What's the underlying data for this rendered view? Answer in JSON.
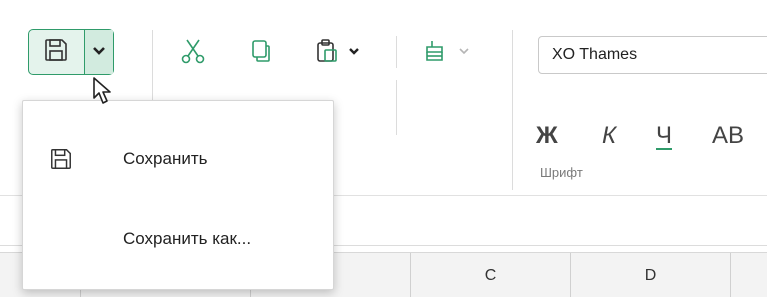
{
  "toolbar": {
    "save_split_button": {
      "icon": "save-icon",
      "dropdown_icon": "chevron-down-icon"
    },
    "clipboard": {
      "cut_icon": "scissors-icon",
      "copy_icon": "copy-icon",
      "paste_icon": "paste-icon",
      "paste_dropdown_icon": "chevron-down-icon"
    },
    "format_painter": {
      "icon": "format-painter-icon",
      "dropdown_icon": "chevron-down-icon"
    }
  },
  "font_group": {
    "font_name": "XO Thames",
    "bold_label": "Ж",
    "italic_label": "К",
    "underline_label": "Ч",
    "strike_label": "АВ",
    "label": "Шрифт"
  },
  "save_menu": {
    "items": [
      {
        "label": "Сохранить",
        "icon": "save-icon"
      },
      {
        "label": "Сохранить как..."
      }
    ]
  },
  "sheet": {
    "columns": [
      "C",
      "D"
    ]
  },
  "colors": {
    "accent": "#2f9b6a",
    "accent_bg": "#e4f3ec"
  }
}
